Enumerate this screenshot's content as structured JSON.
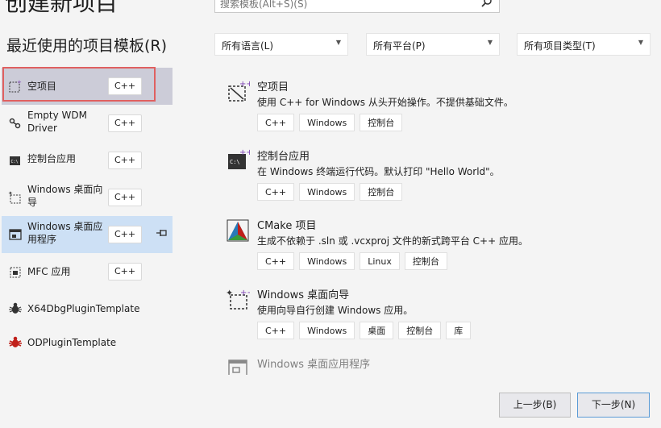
{
  "page": {
    "heading": "创建新项目"
  },
  "search": {
    "placeholder": "搜索模板(Alt+S)(S)"
  },
  "recent": {
    "title": "最近使用的项目模板(R)",
    "items": [
      {
        "name": "空项目",
        "lang": "C++",
        "icon": "empty-project-icon"
      },
      {
        "name": "Empty WDM Driver",
        "lang": "C++",
        "icon": "driver-icon"
      },
      {
        "name": "控制台应用",
        "lang": "C++",
        "icon": "console-icon"
      },
      {
        "name": "Windows 桌面向导",
        "lang": "C++",
        "icon": "wizard-icon"
      },
      {
        "name": "Windows 桌面应用程序",
        "lang": "C++",
        "icon": "desktop-app-icon",
        "pinned": true
      },
      {
        "name": "MFC 应用",
        "lang": "C++",
        "icon": "mfc-icon"
      },
      {
        "name": "X64DbgPluginTemplate",
        "icon": "bug-icon"
      },
      {
        "name": "ODPluginTemplate",
        "icon": "bug-red-icon"
      }
    ]
  },
  "filters": {
    "language": "所有语言(L)",
    "platform": "所有平台(P)",
    "project_type": "所有项目类型(T)"
  },
  "templates": [
    {
      "name": "空项目",
      "desc": "使用 C++ for Windows 从头开始操作。不提供基础文件。",
      "tags": [
        "C++",
        "Windows",
        "控制台"
      ]
    },
    {
      "name": "控制台应用",
      "desc": "在 Windows 终端运行代码。默认打印 \"Hello World\"。",
      "tags": [
        "C++",
        "Windows",
        "控制台"
      ]
    },
    {
      "name": "CMake 项目",
      "desc": "生成不依赖于 .sln 或 .vcxproj 文件的新式跨平台 C++ 应用。",
      "tags": [
        "C++",
        "Windows",
        "Linux",
        "控制台"
      ]
    },
    {
      "name": "Windows 桌面向导",
      "desc": "使用向导自行创建 Windows 应用。",
      "tags": [
        "C++",
        "Windows",
        "桌面",
        "控制台",
        "库"
      ]
    },
    {
      "name": "Windows 桌面应用程序",
      "desc": "",
      "tags": []
    }
  ],
  "buttons": {
    "back": "上一步(B)",
    "next": "下一步(N)"
  },
  "colors": {
    "selected": "#ccccd8",
    "hover": "#cde0f5",
    "focus": "#e06060",
    "accent": "#5a9bd6"
  }
}
